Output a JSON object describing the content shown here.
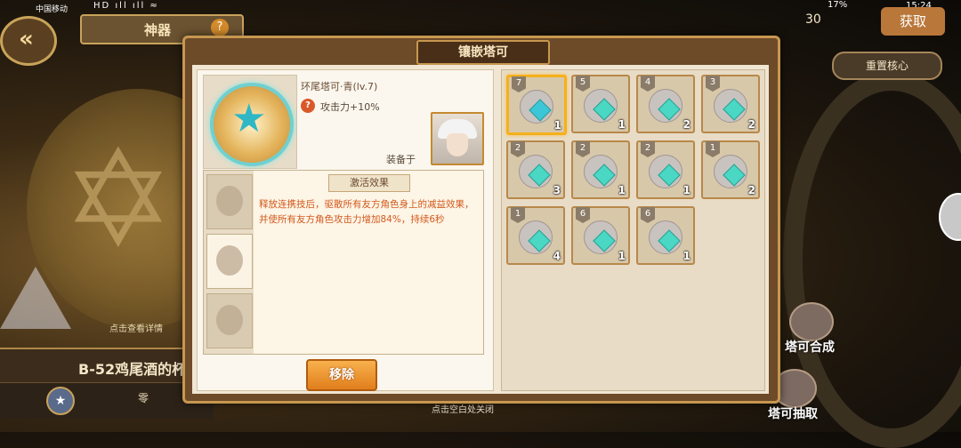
{
  "status_bar": {
    "carrier": "中国移动",
    "signals": "HD ıll ıll ≈",
    "battery": "17%",
    "time": "15:24"
  },
  "background": {
    "title_tab": "神器",
    "help": "?",
    "detail_hint": "点击查看详情",
    "artifact_name": "B-52鸡尾酒的杯",
    "bottom_label": "零",
    "top_count": "30",
    "get_button": "获取",
    "reset_button": "重置核心",
    "combine_button": "塔可合成",
    "draw_button": "塔可抽取",
    "close_hint": "点击空白处关闭"
  },
  "modal": {
    "title": "镶嵌塔可",
    "item": {
      "name": "环尾塔可·青(lv.7)",
      "attribute": "攻击力+10%",
      "equipped_label": "装备于"
    },
    "effect": {
      "title": "激活效果",
      "description": "释放连携技后，驱散所有友方角色身上的减益效果，并使所有友方角色攻击力增加84%，持续6秒"
    },
    "remove_button": "移除",
    "inventory": [
      {
        "level": "7",
        "qty": "1",
        "gem_color": "#3cc6d8",
        "selected": true
      },
      {
        "level": "5",
        "qty": "1",
        "gem_color": "#4ad7c4"
      },
      {
        "level": "4",
        "qty": "2",
        "gem_color": "#4ad7c4"
      },
      {
        "level": "3",
        "qty": "2",
        "gem_color": "#4ad7c4"
      },
      {
        "level": "2",
        "qty": "3",
        "gem_color": "#4ad7c4"
      },
      {
        "level": "2",
        "qty": "1",
        "gem_color": "#4ad7c4"
      },
      {
        "level": "2",
        "qty": "1",
        "gem_color": "#4ad7c4"
      },
      {
        "level": "1",
        "qty": "2",
        "gem_color": "#4ad7c4"
      },
      {
        "level": "1",
        "qty": "4",
        "gem_color": "#4ad7c4"
      },
      {
        "level": "6",
        "qty": "1",
        "gem_color": "#4ad7c4"
      },
      {
        "level": "6",
        "qty": "1",
        "gem_color": "#4ad7c4"
      }
    ]
  }
}
